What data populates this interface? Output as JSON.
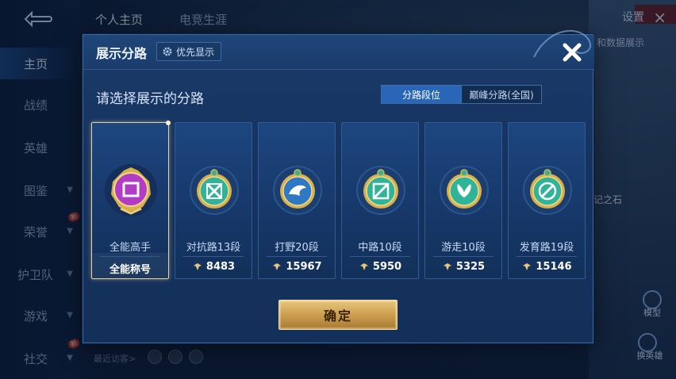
{
  "sidebar": {
    "items": [
      {
        "label": "主页",
        "active": true
      },
      {
        "label": "战绩"
      },
      {
        "label": "英雄"
      },
      {
        "label": "图鉴",
        "chevron": true
      },
      {
        "label": "荣誉",
        "chevron": true,
        "badge": "新"
      },
      {
        "label": "护卫队",
        "chevron": true
      },
      {
        "label": "游戏",
        "chevron": true
      },
      {
        "label": "社交",
        "chevron": true,
        "badge": "新"
      }
    ]
  },
  "topbar": {
    "tabs": [
      "个人主页",
      "电竞生涯"
    ],
    "settings_label": "设置",
    "close_icon": "×"
  },
  "background": {
    "scene_text_1": "和数据展示",
    "scene_text_2": "记之石",
    "recent_visitors_label": "最近访客>",
    "right_buttons": [
      "模型",
      "换英雄"
    ]
  },
  "modal": {
    "title": "展示分路",
    "priority_label": "优先显示",
    "subtitle": "请选择展示的分路",
    "segments": {
      "active": "分路段位",
      "inactive": "巅峰分路(全国)"
    },
    "cards": [
      {
        "name": "全能高手",
        "footer": "全能称号",
        "selected": true,
        "emblem_color": "#b23cc4",
        "emblem": "all-round-emblem"
      },
      {
        "name": "对抗路13段",
        "footer": "8483",
        "emblem_color": "#2fb49a",
        "emblem": "clash-lane-emblem"
      },
      {
        "name": "打野20段",
        "footer": "15967",
        "emblem_color": "#2f78c4",
        "emblem": "jungle-emblem"
      },
      {
        "name": "中路10段",
        "footer": "5950",
        "emblem_color": "#2fb49a",
        "emblem": "mid-lane-emblem"
      },
      {
        "name": "游走10段",
        "footer": "5325",
        "emblem_color": "#2fb49a",
        "emblem": "roam-emblem"
      },
      {
        "name": "发育路19段",
        "footer": "15146",
        "emblem_color": "#2fb49a",
        "emblem": "farm-lane-emblem"
      }
    ],
    "confirm_label": "确定"
  },
  "colors": {
    "accent_gold": "#e8c77d",
    "selected_border": "#e8d39a",
    "segment_active": "#2a66b8"
  }
}
